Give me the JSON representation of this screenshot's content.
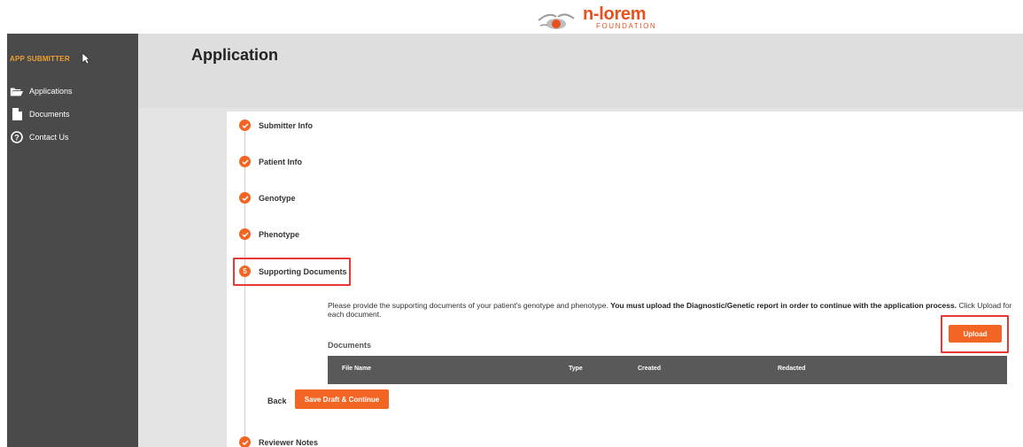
{
  "brand": {
    "name": "n-lorem",
    "subtitle": "FOUNDATION",
    "color": "#e8501e"
  },
  "sidebar": {
    "role_label": "APP SUBMITTER",
    "items": [
      {
        "label": "Applications",
        "icon": "folder-open-icon"
      },
      {
        "label": "Documents",
        "icon": "document-icon"
      },
      {
        "label": "Contact Us",
        "icon": "question-circle-icon"
      }
    ]
  },
  "page": {
    "title": "Application"
  },
  "steps": [
    {
      "label": "Submitter Info",
      "status": "complete"
    },
    {
      "label": "Patient Info",
      "status": "complete"
    },
    {
      "label": "Genotype",
      "status": "complete"
    },
    {
      "label": "Phenotype",
      "status": "complete"
    },
    {
      "label": "Supporting Documents",
      "status": "active",
      "number": "5"
    },
    {
      "label": "Reviewer Notes",
      "status": "complete"
    }
  ],
  "supporting_documents": {
    "intro_text": "Please provide the supporting documents of your patient's genotype and phenotype. ",
    "bold_text": "You must upload the Diagnostic/Genetic report in order to continue with the application process.",
    "tail_text": " Click Upload for each document.",
    "section_title": "Documents",
    "upload_label": "Upload",
    "columns": [
      "File Name",
      "Type",
      "Created",
      "Redacted"
    ]
  },
  "actions": {
    "back_label": "Back",
    "save_label": "Save Draft & Continue"
  },
  "colors": {
    "accent": "#f26522",
    "sidebar_bg": "#4a4a4a",
    "role_color": "#f0a030",
    "highlight": "#e53935"
  }
}
